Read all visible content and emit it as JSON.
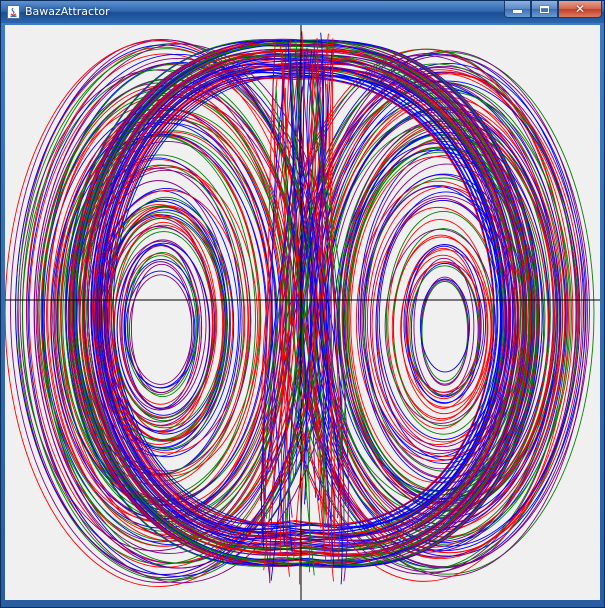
{
  "window": {
    "title": "BawazAttractor"
  },
  "icons": {
    "app": "java-app-icon",
    "minimize": "minimize-icon",
    "maximize": "maximize-icon",
    "close": "close-icon"
  },
  "colors": {
    "title_bar": "#2d65ad",
    "canvas_background": "#f0f0f0",
    "axes": "#000000",
    "trajectories": [
      "#0000ff",
      "#ff0000",
      "#008000",
      "#800080"
    ]
  },
  "plot": {
    "axes": "two black crosshair lines (horizontal and vertical) through the attractor",
    "description": "double-scroll attractor drawn as many overlapping colored trajectories"
  }
}
